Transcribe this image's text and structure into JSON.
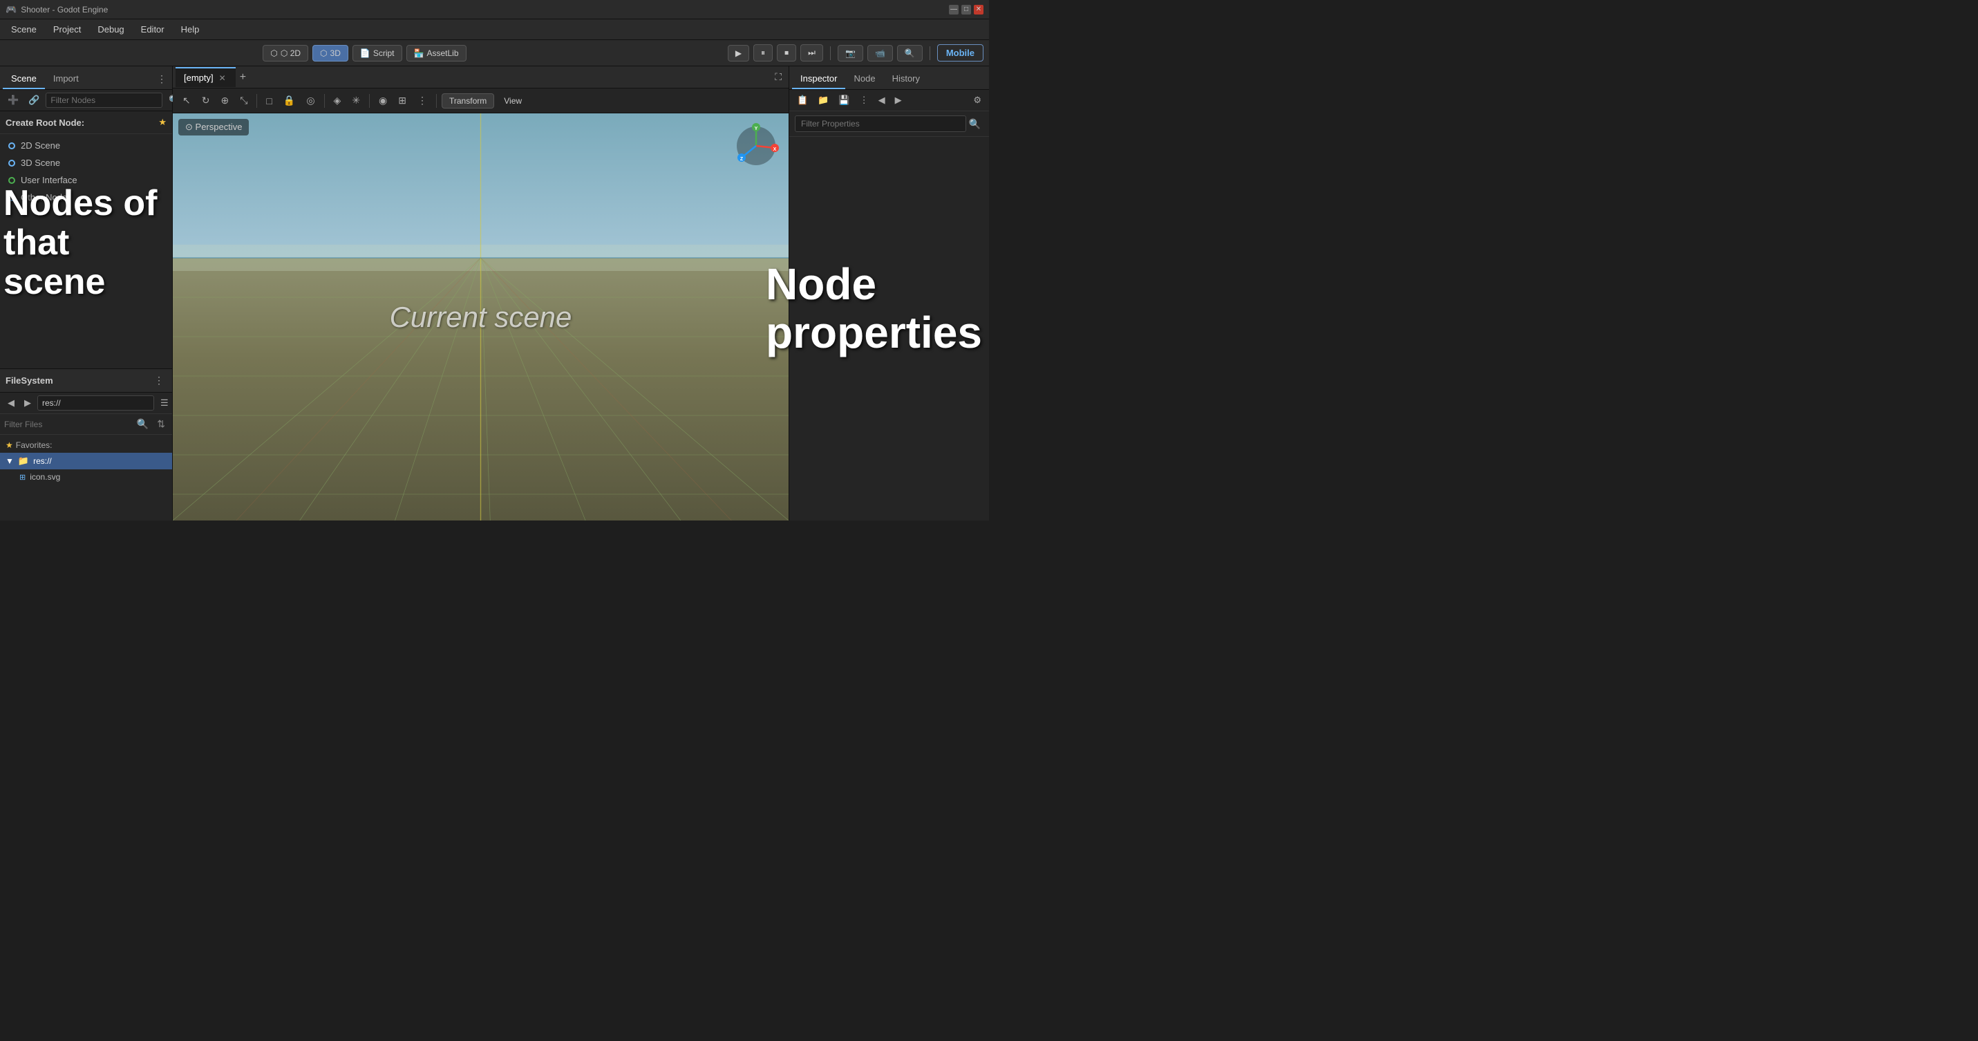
{
  "titlebar": {
    "title": "Shooter - Godot Engine",
    "minimize": "—",
    "maximize": "□",
    "close": "✕"
  },
  "menubar": {
    "items": [
      "Scene",
      "Project",
      "Debug",
      "Editor",
      "Help"
    ]
  },
  "toolbar": {
    "btn2d": "⬡ 2D",
    "btn3d": "⬡ 3D",
    "btnScript": "📄 Script",
    "btnAssetLib": "🏪 AssetLib",
    "play": "▶",
    "pause": "⏸",
    "stop": "⏹",
    "next": "⏭",
    "cameraA": "📷",
    "cameraB": "📹",
    "search": "🔍",
    "mobile": "Mobile"
  },
  "leftPanel": {
    "tabs": [
      "Scene",
      "Import"
    ],
    "filterNodesPlaceholder": "Filter Nodes",
    "createRootLabel": "Create Root Node:",
    "nodes": [
      {
        "id": "node-2dscene",
        "label": "2D Scene",
        "dotColor": "blue"
      },
      {
        "id": "node-3dscene",
        "label": "3D Scene",
        "dotColor": "blue"
      },
      {
        "id": "node-userinterface",
        "label": "User Interface",
        "dotColor": "green"
      },
      {
        "id": "node-other",
        "label": "Other Node",
        "dotColor": "blue"
      }
    ],
    "nodesAnnotation": "Nodes of\nthat scene"
  },
  "filesystem": {
    "title": "FileSystem",
    "path": "res://",
    "filterFilesPlaceholder": "Filter Files",
    "favorites": {
      "label": "Favorites:"
    },
    "tree": [
      {
        "type": "folder",
        "label": "res://",
        "selected": true
      },
      {
        "type": "file",
        "label": "icon.svg",
        "indent": true
      }
    ]
  },
  "viewport": {
    "emptyTab": "[empty]",
    "perspective": "Perspective",
    "currentSceneLabel": "Current scene",
    "tools": {
      "select": "↖",
      "rotate": "↻",
      "pan": "⊕",
      "scale": "⤡",
      "rect": "□",
      "lock": "🔒",
      "pivot": "◎",
      "mesh": "◈",
      "snap": "✳",
      "group": "⊞",
      "env": "◉",
      "more": "⋮",
      "transform": "Transform",
      "view": "View"
    }
  },
  "inspector": {
    "tabs": [
      "Inspector",
      "Node",
      "History"
    ],
    "toolIcons": [
      "📋",
      "📁",
      "💾",
      "⋮",
      "◀",
      "▶"
    ],
    "filterPropertiesPlaceholder": "Filter Properties",
    "filterIcon": "🔍",
    "settingsIcon": "⚙",
    "nodePropsAnnotation": "Node\nproperties"
  }
}
